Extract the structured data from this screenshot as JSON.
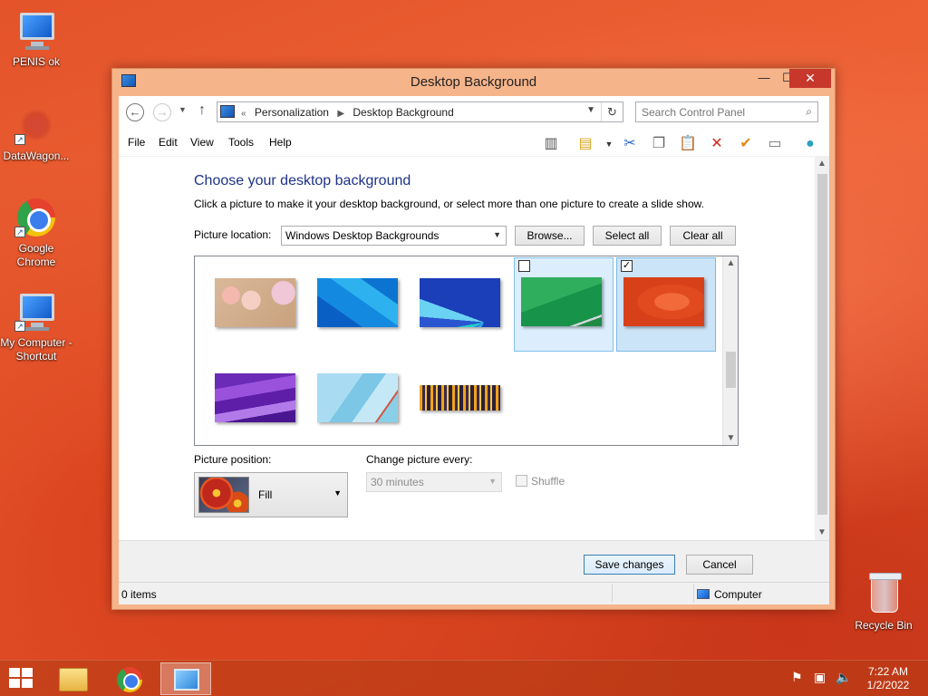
{
  "desktop": {
    "icons": [
      {
        "label": "PENIS ok"
      },
      {
        "label": "DataWagon..."
      },
      {
        "label": "Google Chrome"
      },
      {
        "label": "My Computer - Shortcut"
      },
      {
        "label": "Recycle Bin"
      }
    ]
  },
  "window": {
    "title": "Desktop Background",
    "controls": {
      "minimize": "—",
      "maximize": "☐",
      "close": "✕"
    }
  },
  "navigation": {
    "back": "←",
    "forward": "→",
    "up": "↑",
    "breadcrumb_prefix": "«",
    "breadcrumbs": [
      "Personalization",
      "Desktop Background"
    ],
    "search_placeholder": "Search Control Panel"
  },
  "menu": [
    "File",
    "Edit",
    "View",
    "Tools",
    "Help"
  ],
  "toolbar_icons": [
    "layout-icon",
    "folder-options-icon",
    "dropdown-icon",
    "cut-icon",
    "copy-icon",
    "paste-icon",
    "delete-icon",
    "checkmark-icon",
    "properties-icon",
    "globe-icon"
  ],
  "content": {
    "heading": "Choose your desktop background",
    "subtext": "Click a picture to make it your desktop background, or select more than one picture to create a slide show.",
    "location_label": "Picture location:",
    "location_value": "Windows Desktop Backgrounds",
    "browse": "Browse...",
    "select_all": "Select all",
    "clear_all": "Clear all",
    "thumbnails": [
      {
        "name": "cartoon",
        "selected": false,
        "checked": false
      },
      {
        "name": "blue-lines",
        "selected": false,
        "checked": false
      },
      {
        "name": "blue-petals",
        "selected": false,
        "checked": false
      },
      {
        "name": "green",
        "selected": true,
        "checked": false
      },
      {
        "name": "red-orange",
        "selected": true,
        "checked": true
      },
      {
        "name": "purple",
        "selected": false,
        "checked": false
      },
      {
        "name": "light-blue",
        "selected": false,
        "checked": false
      },
      {
        "name": "city-night",
        "selected": false,
        "checked": false
      }
    ],
    "position_label": "Picture position:",
    "position_value": "Fill",
    "change_label": "Change picture every:",
    "change_value": "30 minutes",
    "shuffle_label": "Shuffle"
  },
  "footer": {
    "save": "Save changes",
    "cancel": "Cancel"
  },
  "status": {
    "items": "0 items",
    "location": "Computer"
  },
  "taskbar": {
    "time": "7:22 AM",
    "date": "1/2/2022"
  }
}
